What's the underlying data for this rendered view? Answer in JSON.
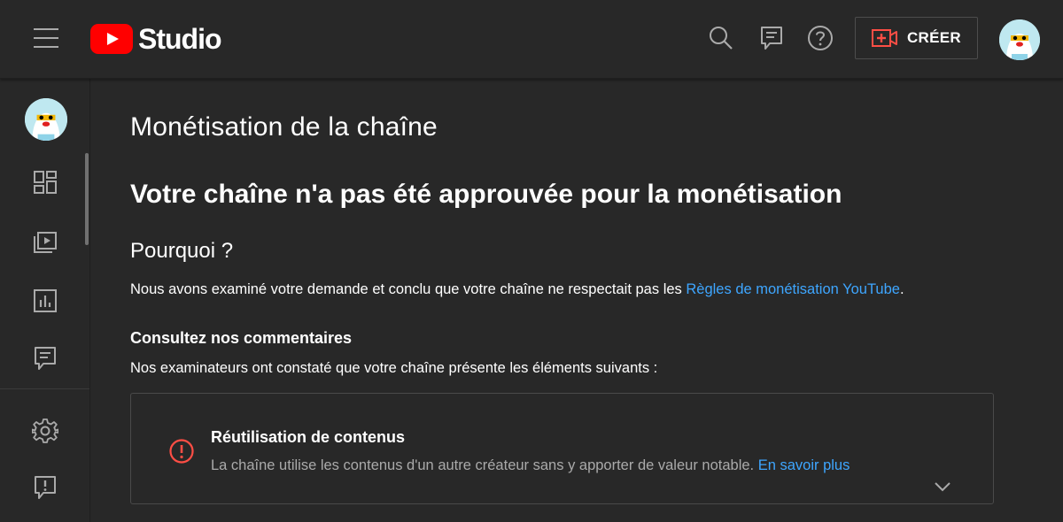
{
  "app": {
    "name": "Studio",
    "create_label": "CRÉER"
  },
  "icons": {
    "menu": "hamburger-menu-icon",
    "search": "search-icon",
    "feedback": "feedback-icon",
    "help": "help-icon",
    "create": "create-video-icon",
    "dashboard": "dashboard-icon",
    "content": "content-icon",
    "analytics": "analytics-icon",
    "comments": "comments-icon",
    "settings": "gear-icon",
    "send_feedback": "report-feedback-icon",
    "error": "error-icon",
    "expand": "chevron-down-icon"
  },
  "colors": {
    "background": "#282828",
    "brand_red": "#ff0000",
    "link": "#3ea6ff",
    "error": "#ff4e45"
  },
  "main": {
    "page_title": "Monétisation de la chaîne",
    "status_title": "Votre chaîne n'a pas été approuvée pour la monétisation",
    "why_heading": "Pourquoi ?",
    "why_text": "Nous avons examiné votre demande et conclu que votre chaîne ne respectait pas les ",
    "why_link": "Règles de monétisation YouTube",
    "why_end": ".",
    "review_heading": "Consultez nos commentaires",
    "review_text": "Nos examinateurs ont constaté que votre chaîne présente les éléments suivants :",
    "issue": {
      "title": "Réutilisation de contenus",
      "description": "La chaîne utilise les contenus d'un autre créateur sans y apporter de valeur notable. ",
      "link": "En savoir plus"
    }
  }
}
